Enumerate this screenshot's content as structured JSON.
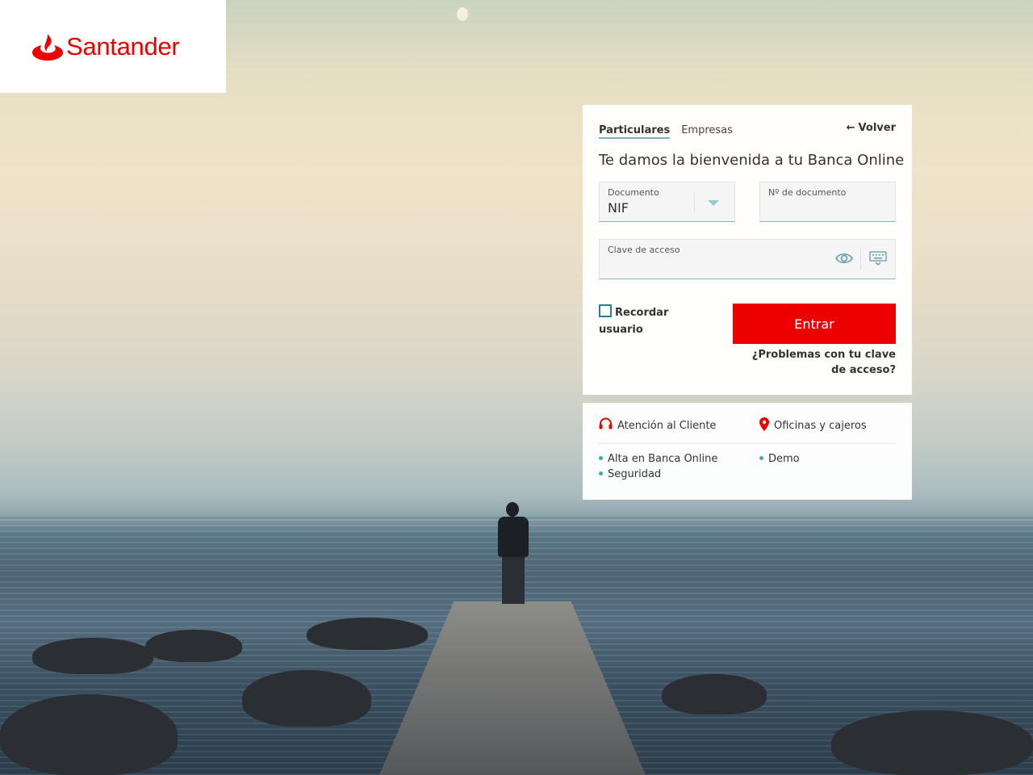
{
  "brand": {
    "name": "Santander",
    "color": "#ec0000"
  },
  "login": {
    "tabs": [
      {
        "label": "Particulares",
        "active": true
      },
      {
        "label": "Empresas",
        "active": false
      }
    ],
    "back_label": "Volver",
    "welcome": "Te damos la bienvenida a tu Banca Online",
    "document_type": {
      "label": "Documento",
      "value": "NIF"
    },
    "document_number": {
      "label": "Nº de documento",
      "value": ""
    },
    "password": {
      "label": "Clave de acceso",
      "value": ""
    },
    "remember_label": "Recordar usuario",
    "remember_checked": false,
    "submit_label": "Entrar",
    "problems_link": "¿Problemas con tu clave de acceso?"
  },
  "help": {
    "customer_service": "Atención al Cliente",
    "branches": "Oficinas y cajeros",
    "links": [
      "Alta en Banca Online",
      "Seguridad",
      "Demo"
    ]
  },
  "icons": {
    "back": "arrow-left-icon",
    "dropdown": "chevron-down-icon",
    "show_password": "eye-icon",
    "keyboard": "keyboard-icon",
    "headset": "headset-icon",
    "location": "map-pin-icon"
  }
}
